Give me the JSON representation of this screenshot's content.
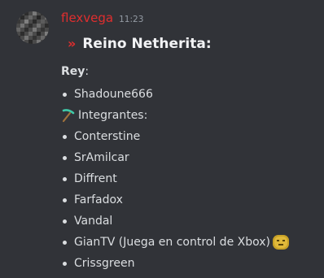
{
  "message": {
    "username": "flexvega",
    "timestamp": "11:23",
    "avatar_icon": "pixel-block-avatar",
    "heading_icon": "double-chevron-right-icon",
    "heading": "Reino Netherita:",
    "rey_label": "Rey",
    "rey_suffix": ":",
    "first_item": "Shadoune666",
    "members_icon": "pickaxe-icon",
    "members_label": "Integrantes:",
    "members": [
      "Conterstine",
      "SrAmilcar",
      "Diffrent",
      "Farfadox",
      "Vandal",
      "GianTV (Juega en control de Xbox)",
      "Crissgreen"
    ],
    "trailing_emoji_icon": "blob-emoji-icon"
  },
  "colors": {
    "background": "#313338",
    "username": "#e02e2e",
    "text": "#dbdee1",
    "timestamp": "#949ba4"
  }
}
